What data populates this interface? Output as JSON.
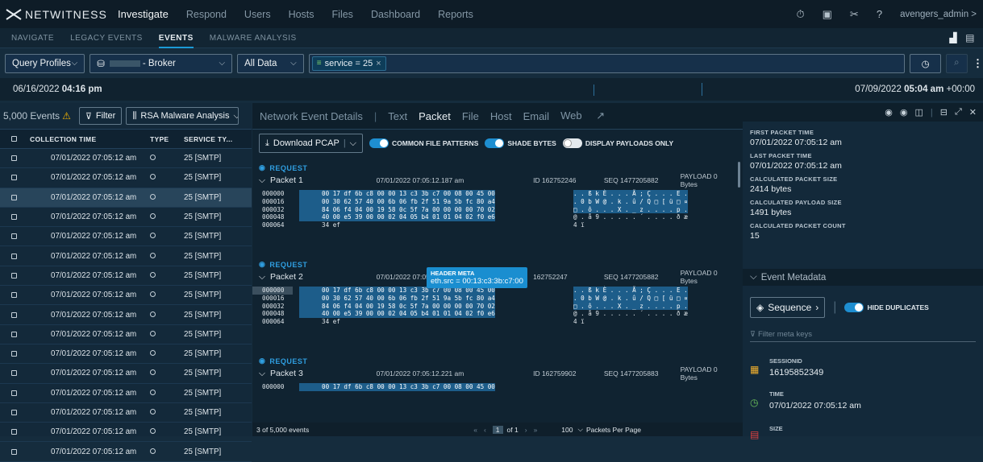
{
  "app": {
    "brand": "NETWITNESS",
    "user": "avengers_admin >"
  },
  "topnav": [
    "Investigate",
    "Respond",
    "Users",
    "Hosts",
    "Files",
    "Dashboard",
    "Reports"
  ],
  "subnav": [
    "NAVIGATE",
    "LEGACY EVENTS",
    "EVENTS",
    "MALWARE ANALYSIS"
  ],
  "query": {
    "profile": "Query Profiles",
    "broker": "- Broker",
    "data": "All Data",
    "chip": "service = 25"
  },
  "range": {
    "start_date": "06/16/2022",
    "start_time": "04:16 pm",
    "end_date": "07/09/2022",
    "end_time": "05:04 am",
    "tz": "+00:00"
  },
  "events": {
    "count": "5,000 Events",
    "filter": "Filter",
    "column_set": "RSA Malware Analysis",
    "columns": [
      "COLLECTION TIME",
      "TYPE",
      "SERVICE TY..."
    ],
    "rows": [
      {
        "time": "07/01/2022 07:05:12 am",
        "service": "25 [SMTP]"
      },
      {
        "time": "07/01/2022 07:05:12 am",
        "service": "25 [SMTP]"
      },
      {
        "time": "07/01/2022 07:05:12 am",
        "service": "25 [SMTP]"
      },
      {
        "time": "07/01/2022 07:05:12 am",
        "service": "25 [SMTP]"
      },
      {
        "time": "07/01/2022 07:05:12 am",
        "service": "25 [SMTP]"
      },
      {
        "time": "07/01/2022 07:05:12 am",
        "service": "25 [SMTP]"
      },
      {
        "time": "07/01/2022 07:05:12 am",
        "service": "25 [SMTP]"
      },
      {
        "time": "07/01/2022 07:05:12 am",
        "service": "25 [SMTP]"
      },
      {
        "time": "07/01/2022 07:05:12 am",
        "service": "25 [SMTP]"
      },
      {
        "time": "07/01/2022 07:05:12 am",
        "service": "25 [SMTP]"
      },
      {
        "time": "07/01/2022 07:05:12 am",
        "service": "25 [SMTP]"
      },
      {
        "time": "07/01/2022 07:05:12 am",
        "service": "25 [SMTP]"
      },
      {
        "time": "07/01/2022 07:05:12 am",
        "service": "25 [SMTP]"
      },
      {
        "time": "07/01/2022 07:05:12 am",
        "service": "25 [SMTP]"
      },
      {
        "time": "07/01/2022 07:05:12 am",
        "service": "25 [SMTP]"
      },
      {
        "time": "07/01/2022 07:05:12 am",
        "service": "25 [SMTP]"
      }
    ]
  },
  "details": {
    "tabs": [
      "Network Event Details",
      "Text",
      "Packet",
      "File",
      "Host",
      "Email",
      "Web"
    ],
    "download": "Download PCAP",
    "toggles": [
      "COMMON FILE PATTERNS",
      "SHADE BYTES",
      "DISPLAY PAYLOADS ONLY"
    ],
    "request": "REQUEST",
    "packets": [
      {
        "name": "Packet 1",
        "time": "07/01/2022 07:05:12.187 am",
        "id": "ID 162752246",
        "seq": "SEQ 1477205882",
        "payload": "PAYLOAD 0 Bytes"
      },
      {
        "name": "Packet 2",
        "time": "07/01/2022 07:05",
        "id": "162752247",
        "seq": "SEQ 1477205882",
        "payload": "PAYLOAD 0 Bytes"
      },
      {
        "name": "Packet 3",
        "time": "07/01/2022 07:05:12.221 am",
        "id": "ID 162759902",
        "seq": "SEQ 1477205883",
        "payload": "PAYLOAD 0 Bytes"
      }
    ],
    "offsets": [
      "000000",
      "000016",
      "000032",
      "000048",
      "000064"
    ],
    "hexrows": [
      "00 17 df 6b c8 00 00 13 c3 3b c7 00 08 00 45 00",
      "00 30 62 57 40 00 6b 06 fb 2f 51 9a 5b fc 80 a4",
      "84 06 f4 04 00 19 58 0c 5f 7a 00 00 00 00 70 02",
      "40 00 e5 39 00 00 02 04 05 b4 01 01 04 02 f0 e6",
      "34 ef"
    ],
    "asciirows": [
      ". . ß k È . . . Ã ; Ç . . . E .",
      ". 0 b W @ . k . û / Q □ [ ü □ ¤",
      "□ . ô . . . X . _ z . . . . p .",
      "@ . å 9 . . . . . ´ . . . . ð æ",
      "4 ï"
    ],
    "packet3_partial": "000000",
    "tooltip": {
      "title": "HEADER META",
      "value": "eth.src = 00:13:c3:3b:c7:00"
    },
    "footer": {
      "count": "3 of 5,000 events",
      "page": "1",
      "of": "of 1",
      "per": "100",
      "per_label": "Packets Per Page"
    }
  },
  "meta": {
    "first_label": "FIRST PACKET TIME",
    "first": "07/01/2022 07:05:12 am",
    "last_label": "LAST PACKET TIME",
    "last": "07/01/2022 07:05:12 am",
    "cps_label": "CALCULATED PACKET SIZE",
    "cps": "2414 bytes",
    "cpl_label": "CALCULATED PAYLOAD SIZE",
    "cpl": "1491 bytes",
    "cpc_label": "CALCULATED PACKET COUNT",
    "cpc": "15",
    "section": "Event Metadata",
    "sequence": "Sequence",
    "hide": "HIDE DUPLICATES",
    "filter_ph": "Filter meta keys",
    "sid_label": "SESSIONID",
    "sid": "16195852349",
    "time_label": "TIME",
    "time": "07/01/2022 07:05:12 am",
    "size_label": "SIZE"
  }
}
